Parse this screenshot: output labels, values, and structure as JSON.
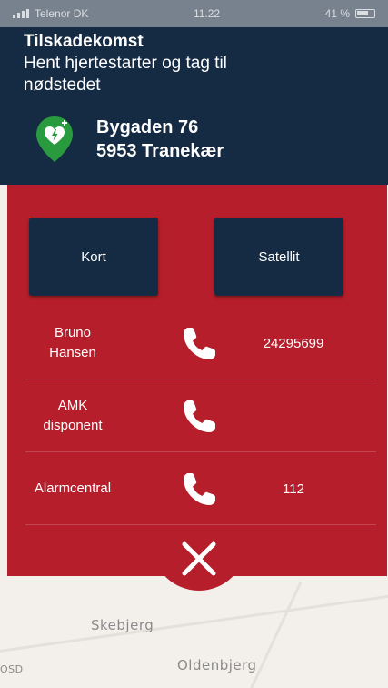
{
  "status": {
    "carrier": "Telenor DK",
    "time": "11.22",
    "battery": "41 %"
  },
  "header": {
    "title": "Tilskadekomst",
    "subtitle": "Hent hjertestarter og tag til nødstedet",
    "address_line1": "Bygaden 76",
    "address_line2": "5953 Tranekær",
    "pin_icon": "aed-location-pin-icon"
  },
  "map_toggle": {
    "kort_label": "Kort",
    "satellite_label": "Satellit"
  },
  "contacts": [
    {
      "name_line1": "Bruno",
      "name_line2": "Hansen",
      "number": "24295699"
    },
    {
      "name_line1": "AMK",
      "name_line2": "disponent",
      "number": ""
    },
    {
      "name_line1": "Alarmcentral",
      "name_line2": "",
      "number": "112"
    }
  ],
  "map": {
    "places": [
      "Skebjerg",
      "Oldenbjerg"
    ],
    "attribution": "OSD"
  },
  "colors": {
    "navy": "#152a43",
    "red": "#b51e2a",
    "aed_green": "#2a9a3f"
  }
}
